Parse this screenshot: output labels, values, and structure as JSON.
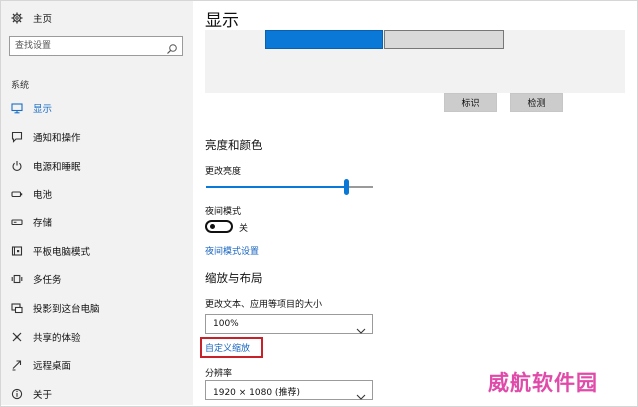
{
  "sidebar": {
    "home_label": "主页",
    "search_placeholder": "查找设置",
    "section_label": "系统",
    "items": [
      {
        "label": "显示",
        "icon": "monitor-icon",
        "selected": true
      },
      {
        "label": "通知和操作",
        "icon": "notification-icon",
        "selected": false
      },
      {
        "label": "电源和睡眠",
        "icon": "power-icon",
        "selected": false
      },
      {
        "label": "电池",
        "icon": "battery-icon",
        "selected": false
      },
      {
        "label": "存储",
        "icon": "storage-icon",
        "selected": false
      },
      {
        "label": "平板电脑模式",
        "icon": "tablet-icon",
        "selected": false
      },
      {
        "label": "多任务",
        "icon": "multitask-icon",
        "selected": false
      },
      {
        "label": "投影到这台电脑",
        "icon": "project-icon",
        "selected": false
      },
      {
        "label": "共享的体验",
        "icon": "shared-icon",
        "selected": false
      },
      {
        "label": "远程桌面",
        "icon": "remote-desktop-icon",
        "selected": false
      },
      {
        "label": "关于",
        "icon": "info-icon",
        "selected": false
      }
    ]
  },
  "main": {
    "title": "显示",
    "identify_label": "标识",
    "detect_label": "检测",
    "brightness_heading": "亮度和颜色",
    "brightness_label": "更改亮度",
    "brightness_value": 0.84,
    "night_mode_label": "夜间模式",
    "night_mode_state": "关",
    "night_mode_settings_link": "夜间模式设置",
    "scale_heading": "缩放与布局",
    "scale_label": "更改文本、应用等项目的大小",
    "scale_value": "100%",
    "custom_scaling_link": "自定义缩放",
    "resolution_label": "分辨率",
    "resolution_value": "1920 × 1080 (推荐)"
  },
  "colors": {
    "accent": "#0a78d6",
    "highlight_border": "#c7212a",
    "watermark": "#e04aa9"
  },
  "watermark": "威航软件园"
}
